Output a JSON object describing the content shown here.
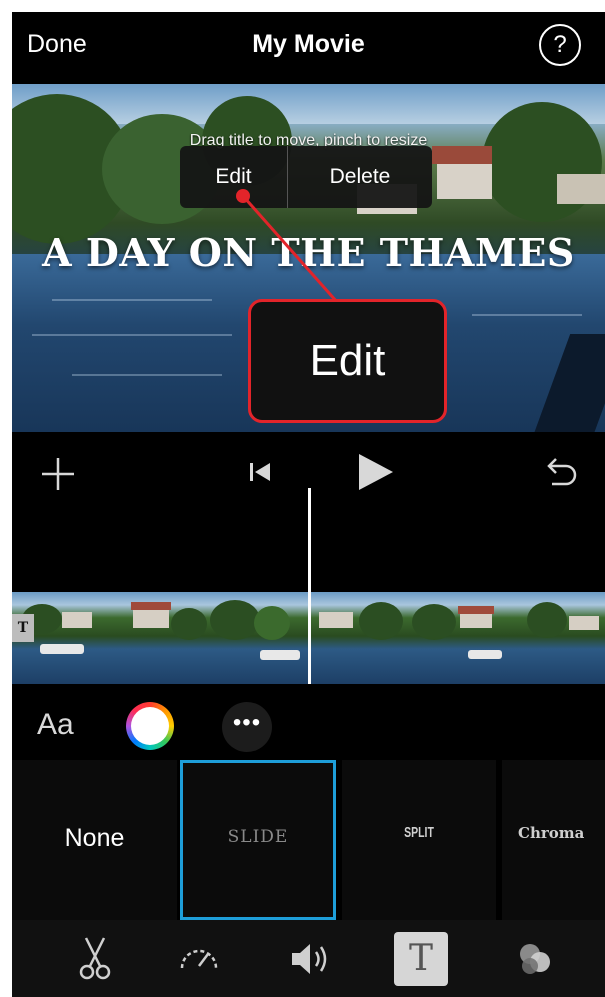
{
  "navbar": {
    "done_label": "Done",
    "title": "My Movie",
    "help_label": "?"
  },
  "preview": {
    "hint": "Drag title to move, pinch to resize",
    "context_menu": {
      "edit_label": "Edit",
      "delete_label": "Delete"
    },
    "title_text": "A DAY ON THE THAMES",
    "callout_label": "Edit"
  },
  "controls": {
    "add_icon": "plus-icon",
    "skip_back_icon": "skip-to-start-icon",
    "play_icon": "play-icon",
    "undo_icon": "undo-icon"
  },
  "timeline": {
    "title_badge": "T"
  },
  "style_row": {
    "font_label": "Aa",
    "more_label": "•••"
  },
  "title_styles": [
    {
      "label": "None",
      "selected": false
    },
    {
      "label": "SLIDE",
      "selected": true
    },
    {
      "label": "SPLIT",
      "selected": false
    },
    {
      "label": "Chroma",
      "selected": false
    }
  ],
  "toolbar": {
    "scissors_icon": "scissors-icon",
    "speed_icon": "speedometer-icon",
    "volume_icon": "speaker-icon",
    "text_label": "T",
    "filters_icon": "filters-icon"
  },
  "colors": {
    "accent_selection": "#1e9ed9",
    "callout_border": "#e2242a"
  }
}
